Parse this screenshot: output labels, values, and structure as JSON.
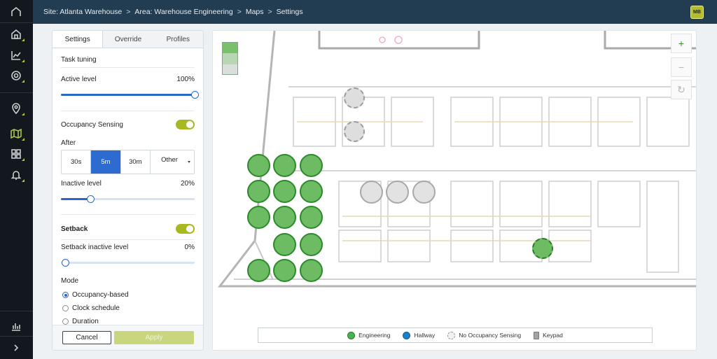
{
  "breadcrumb": [
    "Site: Atlanta Warehouse",
    "Area: Warehouse Engineering",
    "Maps",
    "Settings"
  ],
  "breadcrumb_separator": ">",
  "user_initials": "MB",
  "nav_icons": [
    "home-icon",
    "dashboard-icon",
    "analytics-icon",
    "settings-icon",
    "location-icon",
    "map-icon",
    "grid-icon",
    "bell-icon",
    "bar-chart-icon",
    "expand-icon"
  ],
  "tabs": [
    "Settings",
    "Override",
    "Profiles"
  ],
  "task_tuning": "Task tuning",
  "active_level": {
    "label": "Active level",
    "value": "100%",
    "fraction": 1.0
  },
  "occupancy": {
    "label": "Occupancy Sensing",
    "on": true
  },
  "after": {
    "label": "After",
    "options": [
      "30s",
      "5m",
      "30m",
      "Other"
    ],
    "selected": "5m"
  },
  "inactive_level": {
    "label": "Inactive level",
    "value": "20%",
    "fraction": 0.2
  },
  "setback": {
    "label": "Setback",
    "on": true
  },
  "setback_inactive": {
    "label": "Setback inactive level",
    "value": "0%",
    "fraction": 0
  },
  "mode": {
    "label": "Mode",
    "options": [
      "Occupancy-based",
      "Clock schedule",
      "Duration"
    ],
    "selected": "Occupancy-based"
  },
  "buttons": {
    "cancel": "Cancel",
    "apply": "Apply"
  },
  "zoom": {
    "in": "+",
    "out": "−",
    "reset": "↻"
  },
  "legend": [
    {
      "label": "Engineering",
      "color": "#4caf50",
      "style": "solid"
    },
    {
      "label": "Hallway",
      "color": "#1e7fc8",
      "style": "solid"
    },
    {
      "label": "No Occupancy Sensing",
      "color": "#c8c8c8",
      "style": "dashed"
    },
    {
      "label": "Keypad",
      "color": "#9e9e9e",
      "style": "square"
    }
  ],
  "colors": {
    "accent": "#a8b821",
    "primary": "#2a66c9",
    "topbar": "#223d52",
    "nav": "#12181d",
    "engineering": "#6dbb62"
  }
}
